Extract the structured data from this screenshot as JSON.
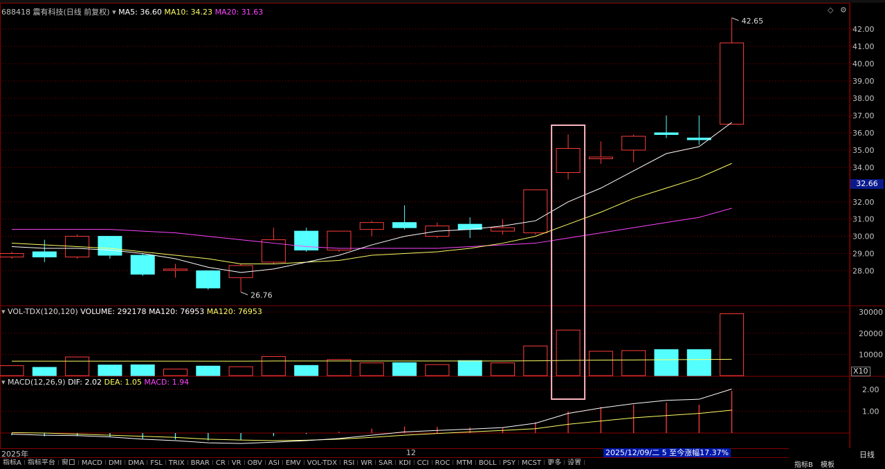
{
  "header": {
    "symbol": "688418",
    "name": "震有科技",
    "period": "(日线 前复权)",
    "ma5_label": "MA5: 36.60",
    "ma10_label": "MA10: 34.23",
    "ma20_label": "MA20: 31.63",
    "ma5_color": "#ffffff",
    "ma10_color": "#ffff66",
    "ma20_color": "#ff44ff"
  },
  "volume_header": {
    "label": "VOL-TDX(120,120)",
    "volume": "VOLUME: 292178",
    "ma120a": "MA120: 76953",
    "ma120b": "MA120: 76953"
  },
  "macd_header": {
    "label": "MACD(12,26,9)",
    "dif": "DIF: 2.02",
    "dea": "DEA: 1.05",
    "macd": "MACD: 1.94"
  },
  "annotations": {
    "high_label": "42.65",
    "low_label": "26.76",
    "current_price": "32.66",
    "vol_multiplier": "X10",
    "year_label": "2025年",
    "month_label": "12",
    "status_text": "2025/12/09/二 5 至今涨幅17.37%"
  },
  "price_axis": [
    "42.00",
    "41.00",
    "40.00",
    "39.00",
    "38.00",
    "37.00",
    "36.00",
    "35.00",
    "34.00",
    "32.00",
    "31.00",
    "30.00",
    "29.00",
    "28.00"
  ],
  "volume_axis": [
    "30000",
    "20000",
    "10000"
  ],
  "macd_axis": [
    "2.00",
    "1.00"
  ],
  "bottom_tabs": [
    "指标A",
    "指标平台",
    "窗口",
    "MACD",
    "DMI",
    "DMA",
    "FSL",
    "TRIX",
    "BRAR",
    "CR",
    "VR",
    "OBV",
    "ASI",
    "EMV",
    "VOL-TDX",
    "RSI",
    "WR",
    "SAR",
    "KDJ",
    "CCI",
    "ROC",
    "MTM",
    "BOLL",
    "PSY",
    "MCST",
    "更多",
    "设置"
  ],
  "right_tabs": {
    "a": "指标B",
    "b": "模板",
    "c": "日线"
  },
  "colors": {
    "up": "#ff3c3c",
    "down": "#54ffff",
    "grid": "#8a0000",
    "ma5": "#ffffff",
    "ma10": "#ffff66",
    "ma20": "#ff44ff",
    "highlight": "#ffb6c1"
  },
  "chart_data": {
    "type": "candlestick",
    "candles": [
      {
        "o": 28.8,
        "c": 29.0,
        "h": 29.1,
        "l": 28.7,
        "v": 4700
      },
      {
        "o": 29.1,
        "c": 28.8,
        "h": 29.8,
        "l": 28.5,
        "v": 3900
      },
      {
        "o": 28.8,
        "c": 30.0,
        "h": 30.1,
        "l": 28.7,
        "v": 8800
      },
      {
        "o": 30.0,
        "c": 28.9,
        "h": 30.0,
        "l": 28.7,
        "v": 5000
      },
      {
        "o": 28.9,
        "c": 27.8,
        "h": 29.0,
        "l": 27.7,
        "v": 5100
      },
      {
        "o": 28.1,
        "c": 28.1,
        "h": 28.4,
        "l": 27.6,
        "v": 3100
      },
      {
        "o": 28.0,
        "c": 27.0,
        "h": 28.0,
        "l": 26.9,
        "v": 4500
      },
      {
        "o": 27.6,
        "c": 28.3,
        "h": 28.4,
        "l": 26.76,
        "v": 4200
      },
      {
        "o": 28.5,
        "c": 29.8,
        "h": 30.5,
        "l": 28.4,
        "v": 9000
      },
      {
        "o": 30.3,
        "c": 29.2,
        "h": 30.5,
        "l": 29.1,
        "v": 4800
      },
      {
        "o": 29.2,
        "c": 30.3,
        "h": 30.3,
        "l": 29.1,
        "v": 7600
      },
      {
        "o": 30.4,
        "c": 30.8,
        "h": 30.9,
        "l": 30.0,
        "v": 6000
      },
      {
        "o": 30.8,
        "c": 30.5,
        "h": 31.8,
        "l": 30.4,
        "v": 6100
      },
      {
        "o": 30.0,
        "c": 30.6,
        "h": 30.8,
        "l": 29.9,
        "v": 5200
      },
      {
        "o": 30.7,
        "c": 30.4,
        "h": 31.1,
        "l": 29.9,
        "v": 7100
      },
      {
        "o": 30.3,
        "c": 30.5,
        "h": 31.0,
        "l": 30.1,
        "v": 6000
      },
      {
        "o": 30.2,
        "c": 32.7,
        "h": 32.7,
        "l": 30.1,
        "v": 14000
      },
      {
        "o": 33.7,
        "c": 35.1,
        "h": 35.9,
        "l": 33.3,
        "v": 21500
      },
      {
        "o": 34.5,
        "c": 34.6,
        "h": 35.5,
        "l": 34.2,
        "v": 11500
      },
      {
        "o": 35.0,
        "c": 35.8,
        "h": 35.9,
        "l": 34.3,
        "v": 11800
      },
      {
        "o": 36.0,
        "c": 35.9,
        "h": 37.0,
        "l": 35.7,
        "v": 12300
      },
      {
        "o": 35.7,
        "c": 35.6,
        "h": 37.0,
        "l": 35.3,
        "v": 12300
      },
      {
        "o": 36.5,
        "c": 41.2,
        "h": 42.65,
        "l": 36.5,
        "v": 29200
      }
    ],
    "ma5": [
      29.4,
      29.3,
      29.3,
      29.2,
      29.0,
      28.7,
      28.2,
      27.9,
      28.1,
      28.5,
      28.9,
      29.5,
      30.0,
      30.3,
      30.4,
      30.6,
      30.9,
      32.0,
      32.8,
      33.8,
      34.8,
      35.2,
      36.6
    ],
    "ma10": [
      29.6,
      29.5,
      29.4,
      29.3,
      29.1,
      28.9,
      28.7,
      28.4,
      28.4,
      28.5,
      28.6,
      28.9,
      29.0,
      29.1,
      29.3,
      29.6,
      30.0,
      30.7,
      31.4,
      32.2,
      32.8,
      33.4,
      34.23
    ],
    "ma20": [
      30.4,
      30.4,
      30.4,
      30.4,
      30.3,
      30.2,
      30.0,
      29.8,
      29.6,
      29.4,
      29.3,
      29.3,
      29.3,
      29.3,
      29.4,
      29.5,
      29.6,
      29.9,
      30.2,
      30.5,
      30.8,
      31.1,
      31.63
    ],
    "vol_ma120": [
      6800,
      6800,
      6800,
      6800,
      6800,
      6800,
      6800,
      6800,
      6900,
      6900,
      6900,
      6900,
      6900,
      6900,
      6900,
      6900,
      7000,
      7200,
      7300,
      7400,
      7500,
      7600,
      7695
    ],
    "dif": [
      -0.05,
      -0.1,
      -0.12,
      -0.18,
      -0.28,
      -0.35,
      -0.45,
      -0.48,
      -0.42,
      -0.35,
      -0.25,
      -0.1,
      0.05,
      0.12,
      0.18,
      0.25,
      0.45,
      0.9,
      1.15,
      1.35,
      1.5,
      1.55,
      2.02
    ],
    "dea": [
      0.02,
      0.0,
      -0.05,
      -0.1,
      -0.15,
      -0.2,
      -0.28,
      -0.32,
      -0.35,
      -0.33,
      -0.28,
      -0.2,
      -0.1,
      -0.02,
      0.05,
      0.12,
      0.2,
      0.4,
      0.55,
      0.7,
      0.8,
      0.9,
      1.05
    ],
    "macd": [
      -0.1,
      -0.15,
      -0.14,
      -0.16,
      -0.26,
      -0.3,
      -0.34,
      -0.32,
      -0.14,
      -0.04,
      0.06,
      0.2,
      0.3,
      0.28,
      0.26,
      0.26,
      0.5,
      1.0,
      1.2,
      1.3,
      1.4,
      1.3,
      1.94
    ],
    "price_range": [
      26.5,
      43.0
    ],
    "volume_range": [
      0,
      32000
    ],
    "macd_range": [
      -0.5,
      2.4
    ]
  }
}
